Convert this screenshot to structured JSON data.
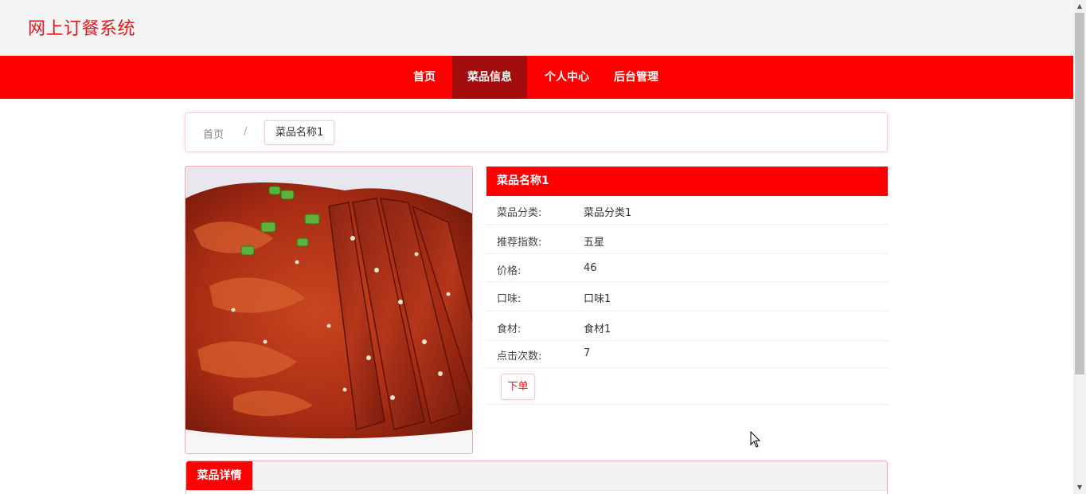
{
  "header": {
    "site_title": "网上订餐系统"
  },
  "nav": {
    "items": [
      {
        "label": "首页",
        "active": false
      },
      {
        "label": "菜品信息",
        "active": true
      },
      {
        "label": "个人中心",
        "active": false
      },
      {
        "label": "后台管理",
        "active": false
      }
    ]
  },
  "breadcrumb": {
    "home": "首页",
    "separator": "/",
    "current": "菜品名称1"
  },
  "dish": {
    "name": "菜品名称1",
    "fields": [
      {
        "label": "菜品分类:",
        "value": "菜品分类1"
      },
      {
        "label": "推荐指数:",
        "value": "五星"
      },
      {
        "label": "价格:",
        "value": "46"
      },
      {
        "label": "口味:",
        "value": "口味1"
      },
      {
        "label": "食材:",
        "value": "食材1"
      },
      {
        "label": "点击次数:",
        "value": "7"
      }
    ],
    "order_button": "下单",
    "image_icon": "dish-photo"
  },
  "detail": {
    "tab_label": "菜品详情"
  },
  "colors": {
    "brand": "#ff0000",
    "nav_active": "#a20c0c",
    "title": "#e8161a"
  }
}
